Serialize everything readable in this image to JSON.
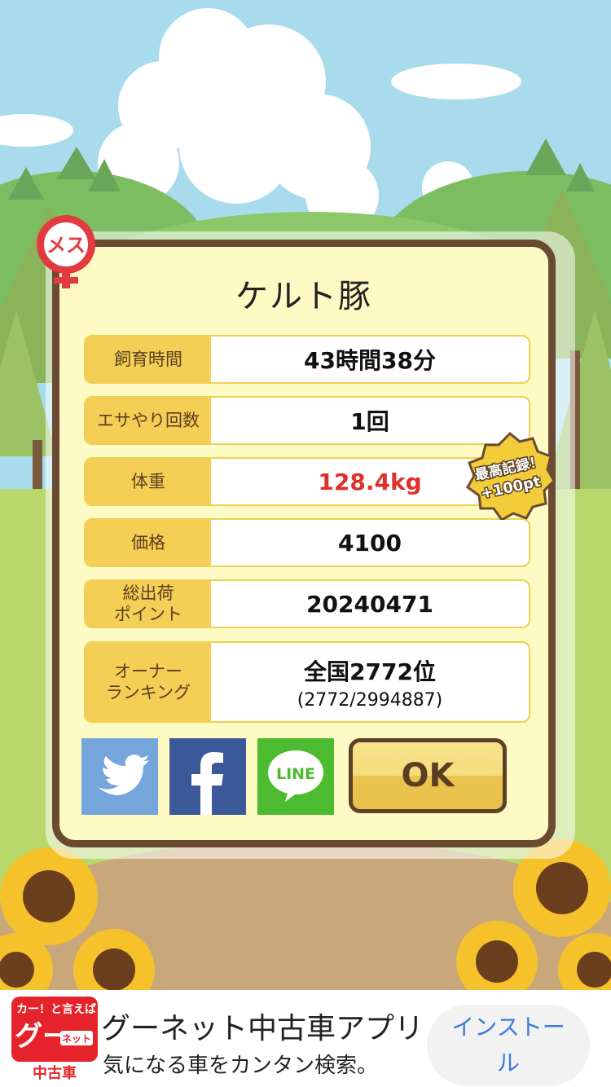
{
  "pig": {
    "name": "ケルト豚",
    "gender_icon": "female-symbol-icon",
    "gender_label": "メス"
  },
  "stats": [
    {
      "label": "飼育時間",
      "value": "43時間38分"
    },
    {
      "label": "エサやり回数",
      "value": "1回"
    },
    {
      "label": "体重",
      "value": "128.4kg"
    },
    {
      "label": "価格",
      "value": "4100"
    },
    {
      "label": "総出荷\nポイント",
      "value": "20240471"
    },
    {
      "label": "オーナー\nランキング",
      "value": "全国2772位",
      "sub": "(2772/2994887)"
    }
  ],
  "badge": {
    "line1": "最高記録！",
    "line2": "+100pt"
  },
  "share": [
    {
      "name": "twitter",
      "icon": "twitter-bird-icon",
      "color": "#74a6dc"
    },
    {
      "name": "facebook",
      "icon": "facebook-f-icon",
      "color": "#3b5998"
    },
    {
      "name": "line",
      "icon": "line-icon",
      "text": "LINE",
      "color": "#4cbb2f"
    }
  ],
  "ok_label": "OK",
  "ad": {
    "logo_top": "カー！と言えば",
    "logo_main": "グー",
    "logo_net": "ネット",
    "logo_bottom": "中古車",
    "title": "グーネット中古車アプリ",
    "subtitle": "気になる車をカンタン検索。",
    "button": "インストール"
  },
  "colors": {
    "accent_red": "#e0302d",
    "label_yellow": "#f4ce55",
    "frame_brown": "#6b4a32"
  }
}
